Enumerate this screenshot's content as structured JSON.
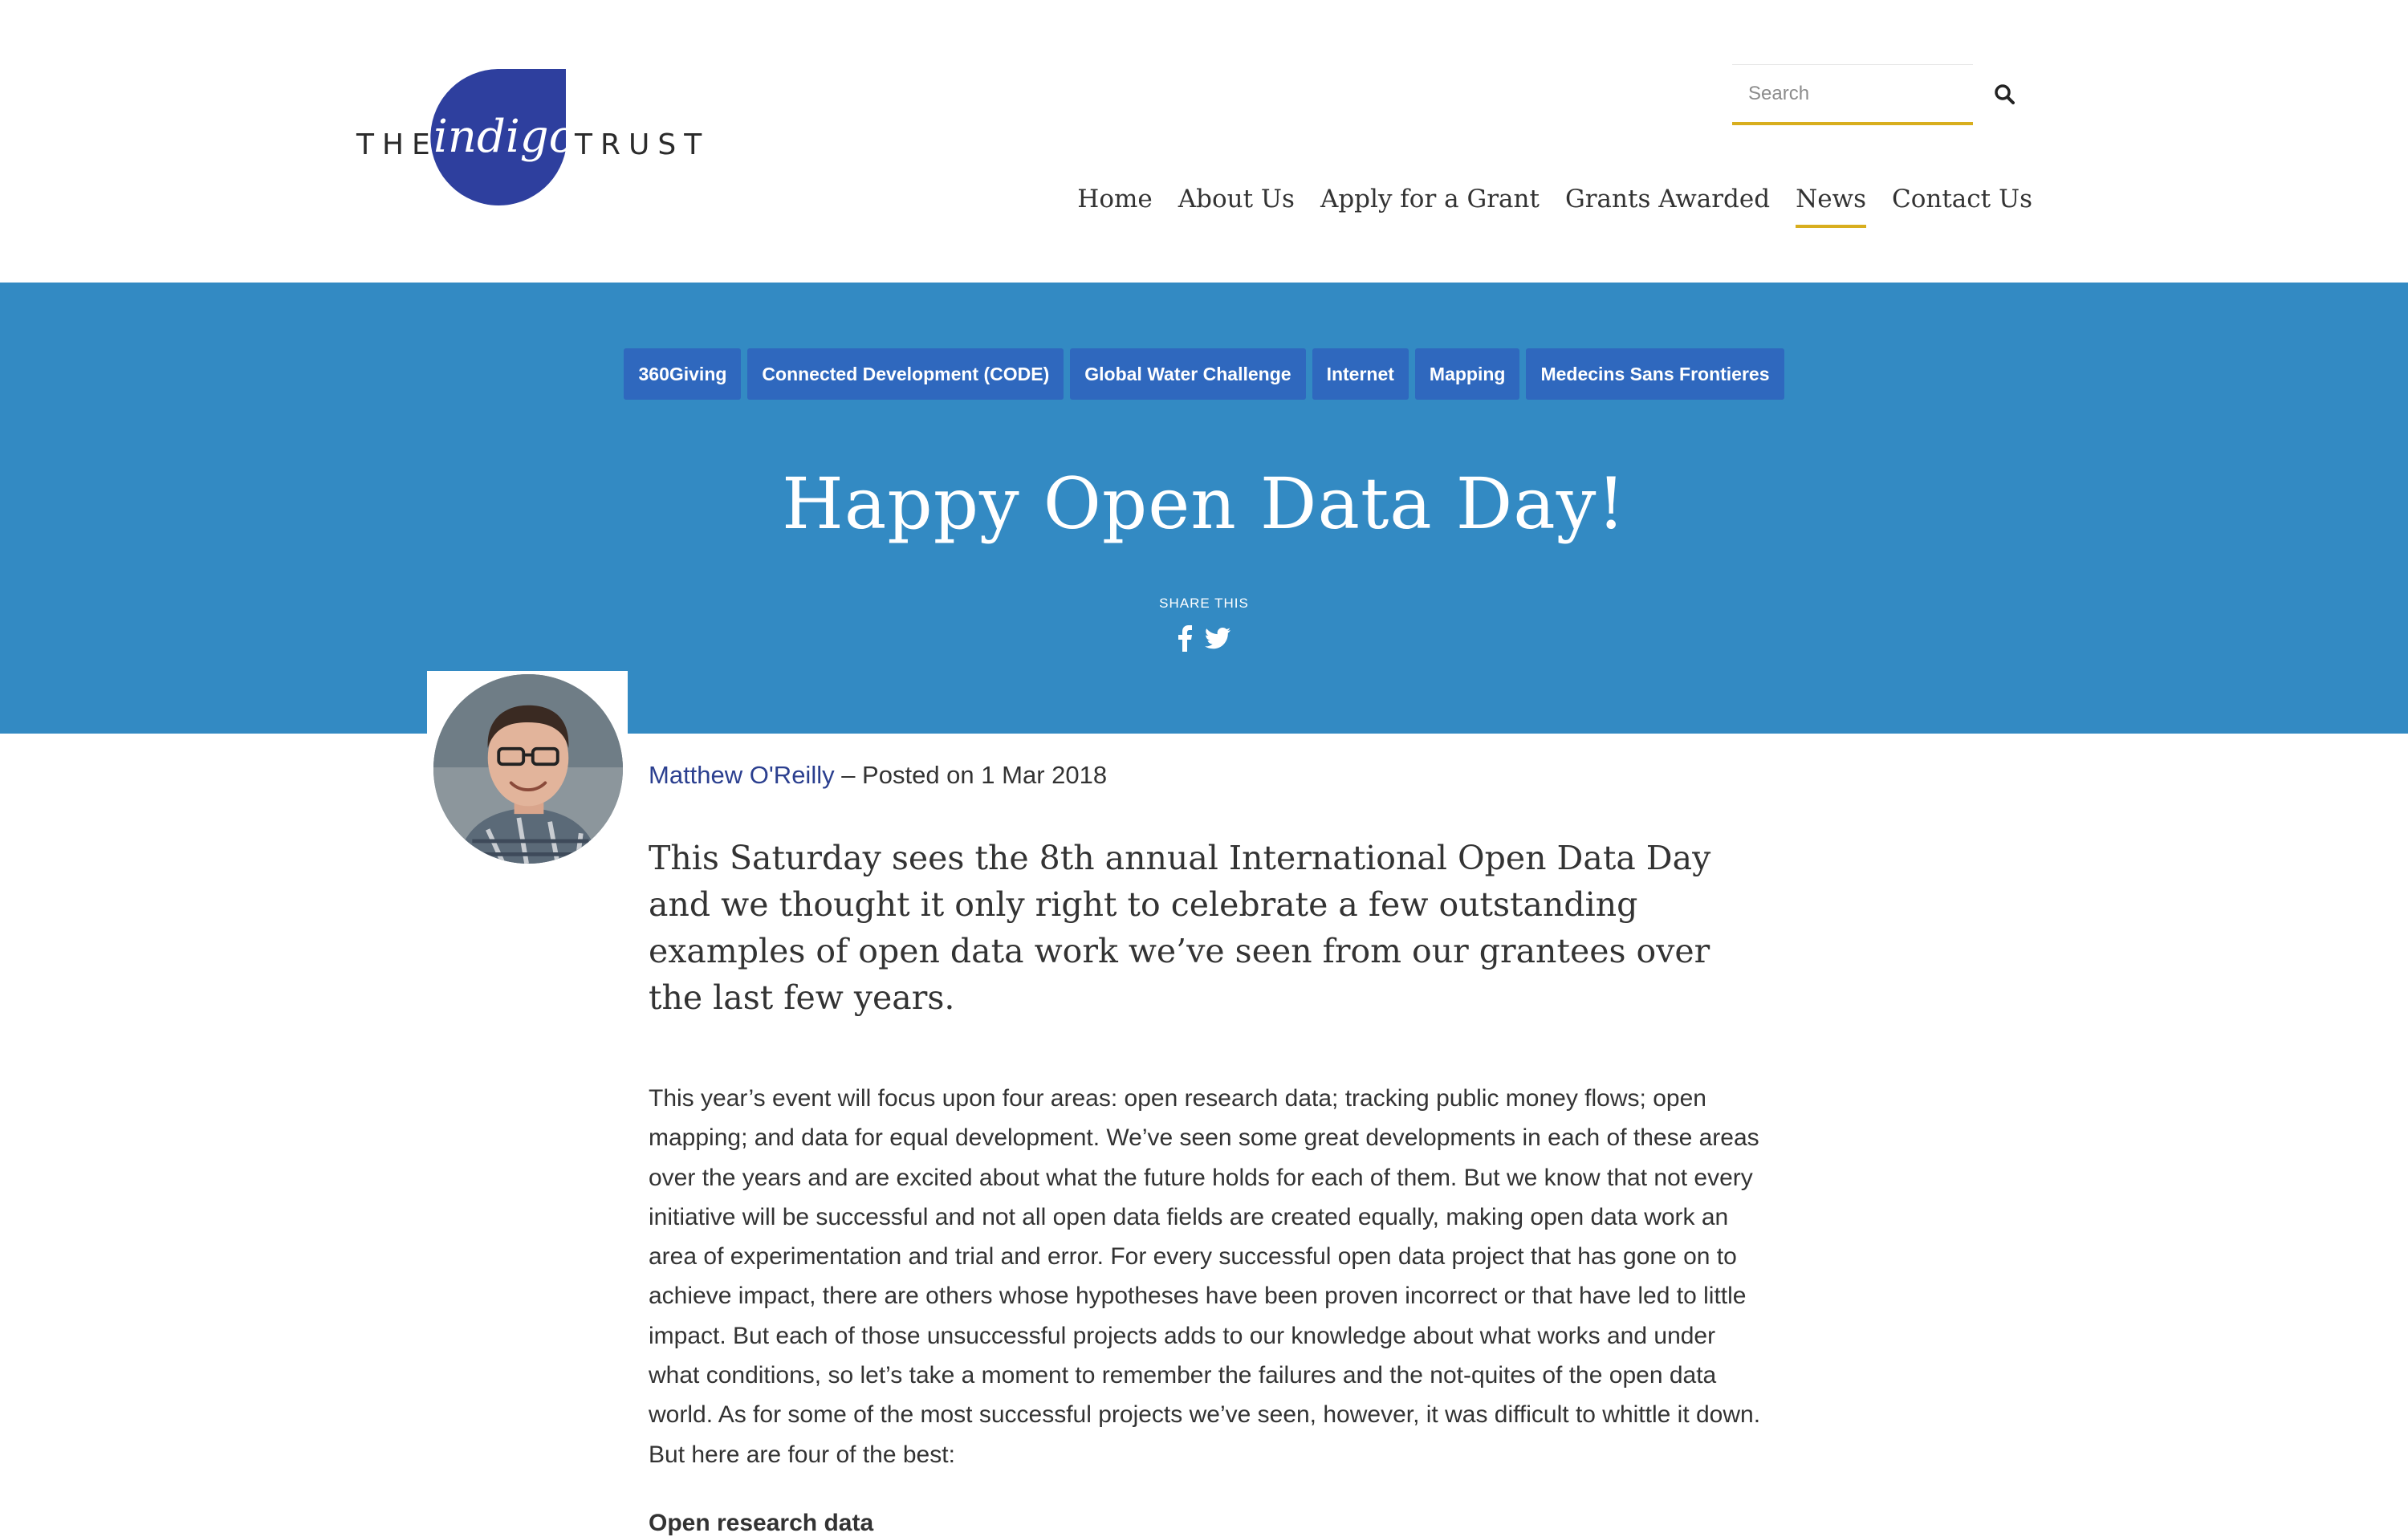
{
  "brand": {
    "word_left": "THE",
    "word_center": "indigo",
    "word_right": "TRUST",
    "accent_color": "#d8ae1e",
    "logo_color": "#2e3f9e"
  },
  "search": {
    "placeholder": "Search",
    "icon": "search-icon"
  },
  "nav": {
    "items": [
      "Home",
      "About Us",
      "Apply for a Grant",
      "Grants Awarded",
      "News",
      "Contact Us"
    ],
    "active": "News"
  },
  "banner": {
    "color": "#338ac3",
    "tags": [
      "360Giving",
      "Connected Development (CODE)",
      "Global Water Challenge",
      "Internet",
      "Mapping",
      "Medecins Sans Frontieres"
    ],
    "title": "Happy Open Data Day!",
    "share_label": "SHARE THIS",
    "share_icons": [
      "facebook-icon",
      "twitter-icon"
    ]
  },
  "article": {
    "author": "Matthew O'Reilly",
    "posted": " – Posted on 1 Mar 2018",
    "lead": "This Saturday sees the 8th annual International Open Data Day and we thought it only right to celebrate a few outstanding examples of open data work we’ve seen from our grantees over the last few years.",
    "body": "This year’s event will focus upon four areas: open research data; tracking public money flows; open mapping; and data for equal development. We’ve seen some great developments in each of these areas over the years and are excited about what the future holds for each of them. But we know that not every initiative will be successful and not all open data fields are created equally, making open data work an area of experimentation and trial and error. For every successful open data project that has gone on to achieve impact, there are others whose hypotheses have been proven incorrect or that have led to little impact. But each of those unsuccessful projects adds to our knowledge about what works and under what conditions, so let’s take a moment to remember the failures and the not-quites of the open data world. As for some of the most successful projects we’ve seen, however, it was difficult to whittle it down. But here are four of the best:",
    "subhead": "Open research data"
  }
}
